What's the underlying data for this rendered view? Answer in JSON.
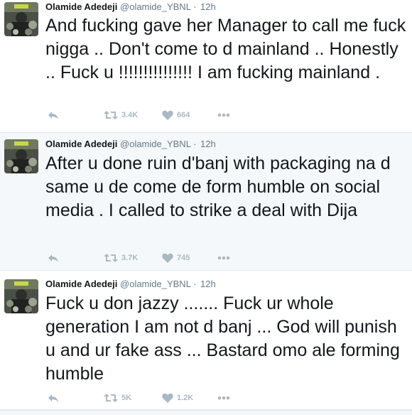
{
  "colors": {
    "icon": "#aab8c2",
    "name": "#14171a",
    "meta": "#657786",
    "stripe": "#f5f8fa"
  },
  "tweets": [
    {
      "name": "Olamide Adedeji",
      "handle": "@olamide_YBNL",
      "dot": "·",
      "time": "12h",
      "text": "And fucking gave her Manager to call me fuck nigga .. Don't come to d mainland .. Honestly .. Fuck u !!!!!!!!!!!!!!! I am fucking mainland .",
      "retweets": "3.4K",
      "likes": "664"
    },
    {
      "name": "Olamide Adedeji",
      "handle": "@olamide_YBNL",
      "dot": "·",
      "time": "12h",
      "text": "After u done ruin d'banj with packaging na d same u de come de form humble on social media . I called to strike a deal with Dija",
      "retweets": "3.7K",
      "likes": "745"
    },
    {
      "name": "Olamide Adedeji",
      "handle": "@olamide_YBNL",
      "dot": "·",
      "time": "12h",
      "text": "Fuck u don jazzy ....... Fuck ur whole generation I am not d banj ... God will punish u and ur fake ass ... Bastard omo ale forming humble",
      "retweets": "5K",
      "likes": "1.2K"
    }
  ]
}
